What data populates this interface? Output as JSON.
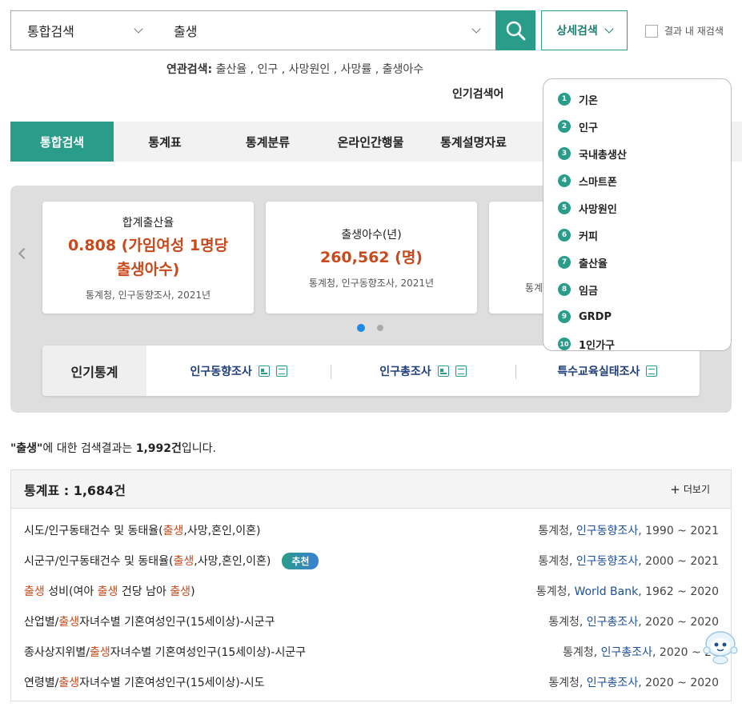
{
  "search": {
    "scope": "통합검색",
    "query": "출생",
    "detail_label": "상세검색",
    "recheck_label": "결과 내 재검색"
  },
  "related": {
    "label": "연관검색",
    "terms": [
      "출산율",
      "인구",
      "사망원인",
      "사망률",
      "출생아수"
    ]
  },
  "popular_label": "인기검색어",
  "popular_terms": [
    "기온",
    "인구",
    "국내총생산",
    "스마트폰",
    "사망원인",
    "커피",
    "출산율",
    "임금",
    "GRDP",
    "1인가구"
  ],
  "tabs": [
    "통합검색",
    "통계표",
    "통계분류",
    "온라인간행물",
    "통계설명자료"
  ],
  "cards": [
    {
      "title": "합계출산율",
      "value": "0.808 (가임여성 1명당 출생아수)",
      "source": "통계청, 인구동향조사, 2021년"
    },
    {
      "title": "출생아수(년)",
      "value": "260,562 (명)",
      "source": "통계청, 인구동향조사, 2021년"
    },
    {
      "title": "",
      "value": "",
      "source": "통계"
    }
  ],
  "carousel": {
    "pages": 2,
    "current": 1
  },
  "popular_stats": {
    "label": "인기통계",
    "items": [
      {
        "name": "인구동향조사"
      },
      {
        "name": "인구총조사"
      },
      {
        "name": "특수교육실태조사"
      }
    ]
  },
  "summary": {
    "query_quoted": "\"출생\"",
    "mid": "에 대한 검색결과는 ",
    "count": "1,992건",
    "end": "입니다."
  },
  "results": {
    "header": "통계표 : 1,684건",
    "more_label": "더보기",
    "badge_label": "추천",
    "rows": [
      {
        "title": [
          "시도/인구동태건수 및 동태율(",
          "출생",
          ",사망,혼인,이혼)"
        ],
        "org": "통계청, ",
        "survey": "인구동향조사",
        "range": ", 1990 ~ 2021"
      },
      {
        "title": [
          "시군구/인구동태건수 및 동태율(",
          "출생",
          ",사망,혼인,이혼)"
        ],
        "org": "통계청, ",
        "survey": "인구동향조사",
        "range": ", 2000 ~ 2021"
      },
      {
        "title": [
          "",
          "출생",
          " 성비(여아 ",
          "출생",
          " 건당 남아 ",
          "출생",
          ")"
        ],
        "org": "통계청, ",
        "survey": "World Bank",
        "range": ", 1962 ~ 2020"
      },
      {
        "title": [
          "산업별/",
          "출생",
          "자녀수별 기혼여성인구(15세이상)-시군구"
        ],
        "org": "통계청, ",
        "survey": "인구총조사",
        "range": ", 2020 ~ 2020"
      },
      {
        "title": [
          "종사상지위별/",
          "출생",
          "자녀수별 기혼여성인구(15세이상)-시군구"
        ],
        "org": "통계청, ",
        "survey": "인구총조사",
        "range": ", 2020 ~ 20"
      },
      {
        "title": [
          "연령별/",
          "출생",
          "자녀수별 기혼여성인구(15세이상)-시도"
        ],
        "org": "통계청, ",
        "survey": "인구총조사",
        "range": ", 2020 ~ 2020"
      }
    ]
  }
}
